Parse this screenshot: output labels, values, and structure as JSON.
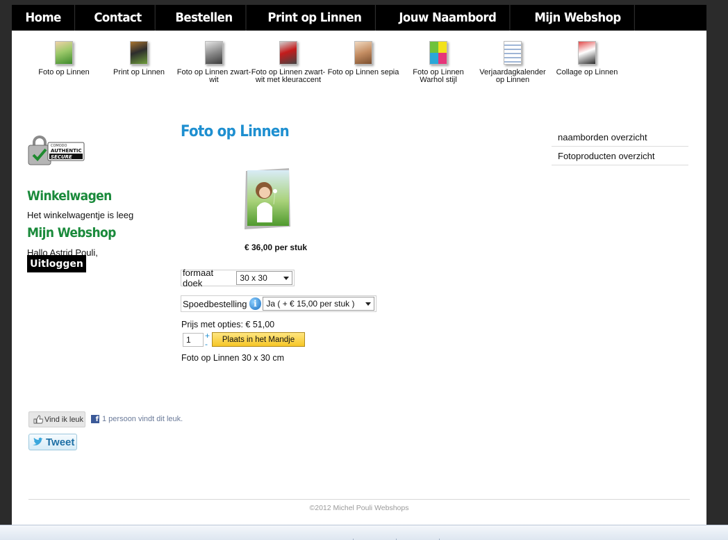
{
  "topnav": {
    "items": [
      {
        "label": "Home"
      },
      {
        "label": "Contact"
      },
      {
        "label": "Bestellen"
      },
      {
        "label": "Print op Linnen"
      },
      {
        "label": "Jouw Naambord"
      },
      {
        "label": "Mijn Webshop"
      }
    ]
  },
  "subnav": {
    "items": [
      {
        "label": "Foto op Linnen",
        "icon": "photo-canvas-icon"
      },
      {
        "label": "Print op Linnen",
        "icon": "print-canvas-icon"
      },
      {
        "label": "Foto op Linnen zwart-wit",
        "icon": "bw-canvas-icon"
      },
      {
        "label": "Foto op Linnen zwart-wit met kleuraccent",
        "icon": "color-accent-canvas-icon"
      },
      {
        "label": "Foto op Linnen sepia",
        "icon": "sepia-canvas-icon"
      },
      {
        "label": "Foto op Linnen Warhol stijl",
        "icon": "warhol-canvas-icon"
      },
      {
        "label": "Verjaardagkalender op Linnen",
        "icon": "calendar-canvas-icon"
      },
      {
        "label": "Collage op Linnen",
        "icon": "collage-canvas-icon"
      }
    ]
  },
  "left": {
    "badge": {
      "top": "COMODO",
      "line1": "AUTHENTIC",
      "line2": "SECURE"
    },
    "cart_title": "Winkelwagen",
    "cart_text": "Het winkelwagentje is leeg",
    "shop_title": "Mijn Webshop",
    "greeting": "Hallo Astrid Pouli,",
    "logout_label": "Uitloggen"
  },
  "right": {
    "links": [
      {
        "label": "naamborden overzicht"
      },
      {
        "label": "Fotoproducten overzicht"
      }
    ]
  },
  "product": {
    "title": "Foto op Linnen",
    "price": "€ 36,00 per stuk",
    "format_label": "formaat doek",
    "format_value": "30 x 30",
    "speed_label": "Spoedbestelling",
    "speed_value": "Ja ( + € 15,00 per stuk )",
    "price_with_options": "Prijs met opties: € 51,00",
    "quantity": "1",
    "plus": "+",
    "minus": "-",
    "add_to_cart": "Plaats in het Mandje",
    "description": "Foto op Linnen 30 x 30 cm"
  },
  "social": {
    "like_label": "Vind ik leuk",
    "like_count": "1 persoon vindt dit leuk.",
    "tweet_label": "Tweet"
  },
  "footer": {
    "copyright": "©2012 Michel Pouli Webshops"
  },
  "colors": {
    "nav_bg": "#000000",
    "title_blue": "#1e8fd0",
    "section_green": "#1a8a3b",
    "button_yellow": "#f6c627"
  }
}
